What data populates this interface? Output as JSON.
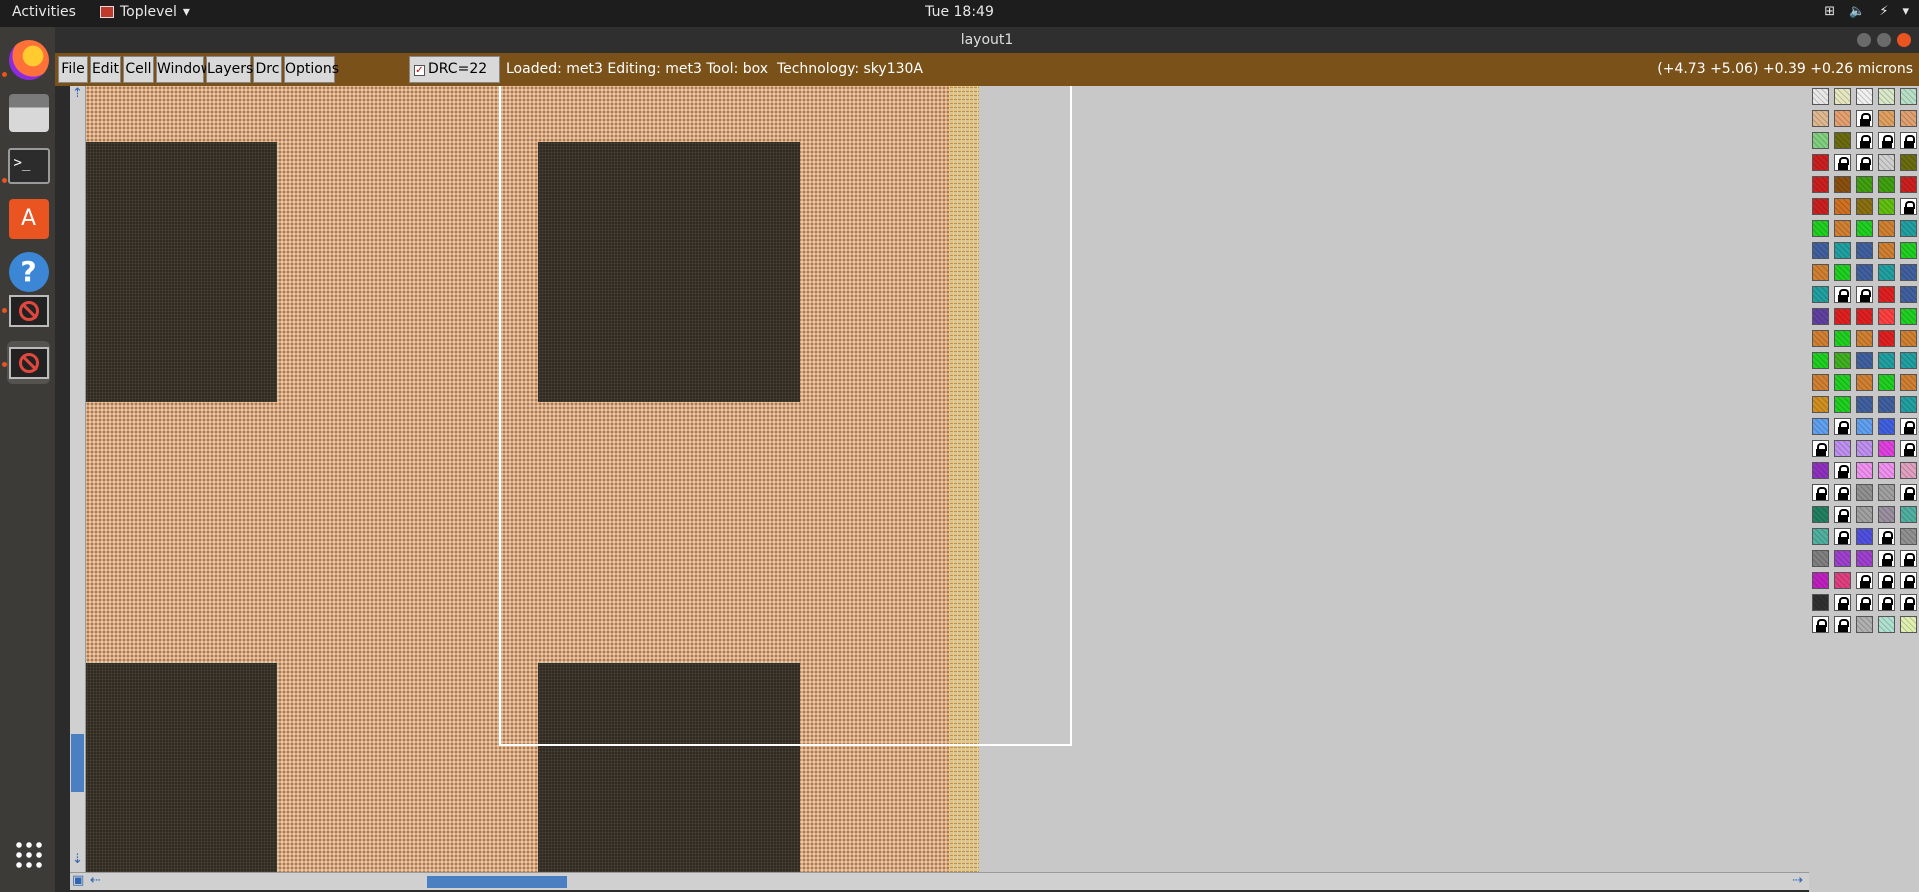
{
  "topbar": {
    "activities": "Activities",
    "app_name": "Toplevel",
    "clock": "Tue 18:49"
  },
  "window": {
    "title": "layout1"
  },
  "menubar": {
    "menus": [
      "File",
      "Edit",
      "Cell",
      "Window",
      "Layers",
      "Drc",
      "Options"
    ],
    "drc_label": "DRC=22",
    "status": "Loaded: met3 Editing: met3 Tool: box  Technology: sky130A",
    "coords": "(+4.73 +5.06) +0.39 +0.26 microns"
  },
  "dock": {
    "items": [
      "firefox-icon",
      "files-icon",
      "terminal-icon",
      "software-center-icon",
      "help-icon",
      "x11-app-icon",
      "x11-app-icon",
      "show-applications-icon"
    ]
  },
  "palette": {
    "rows": [
      [
        "#e8e8e8",
        "#e6e6c0",
        "#f0f0f0",
        "#d8e8c8",
        "#b8e0c8"
      ],
      [
        "#e0b890",
        "#e6a070",
        "lock",
        "#e0a060",
        "#e0a070"
      ],
      [
        "#80d080",
        "#6b6b10",
        "lock",
        "lock",
        "lock"
      ],
      [
        "#cc2020",
        "lock",
        "lock",
        "#d0d0d0",
        "#6b6b10"
      ],
      [
        "#cc2020",
        "#8a5010",
        "#40a010",
        "#40a010",
        "#cc2020"
      ],
      [
        "#cc2020",
        "#d07020",
        "#8a7010",
        "#60c010",
        "lock"
      ],
      [
        "#20d020",
        "#d08030",
        "#20d020",
        "#d08030",
        "#20a0a0"
      ],
      [
        "#4060a0",
        "#20a0a0",
        "#4060a0",
        "#d08030",
        "#20d020"
      ],
      [
        "#d08030",
        "#20d020",
        "#4060a0",
        "#20a0a0",
        "#4060a0"
      ],
      [
        "#20a0a0",
        "lock",
        "lock",
        "#e02020",
        "#4060a0"
      ],
      [
        "#6040a0",
        "#e02020",
        "#e02020",
        "#ff4040",
        "#20d020"
      ],
      [
        "#d08030",
        "#20d020",
        "#d08030",
        "#e02020",
        "#d08030"
      ],
      [
        "#20d020",
        "#40b020",
        "#4060a0",
        "#20a0a0",
        "#20a0a0"
      ],
      [
        "#d08030",
        "#20d020",
        "#d08030",
        "#20d020",
        "#d08030"
      ],
      [
        "#d09020",
        "#20d020",
        "#4060a0",
        "#4060a0",
        "#20a0a0"
      ],
      [
        "#60a0f0",
        "lock",
        "#60a0f0",
        "#4060e0",
        "lock"
      ],
      [
        "lock",
        "#c090f0",
        "#c090f0",
        "#e040e0",
        "lock"
      ],
      [
        "#9030c0",
        "lock",
        "#f090f0",
        "#f090f0",
        "#e0a0c0"
      ],
      [
        "lock",
        "lock",
        "#909090",
        "#a0a0a0",
        "lock"
      ],
      [
        "#208060",
        "lock",
        "#a0a0a0",
        "#9a90a0",
        "#50b0a0"
      ],
      [
        "#50b0a0",
        "lock",
        "#5050e0",
        "lock",
        "#909090"
      ],
      [
        "#808080",
        "#a040d0",
        "#a040d0",
        "lock",
        "lock"
      ],
      [
        "#c020c0",
        "#e04080",
        "lock",
        "lock",
        "lock"
      ],
      [
        "#303030",
        "lock",
        "lock",
        "lock",
        "lock"
      ],
      [
        "lock",
        "lock",
        "#b0b0b0",
        "#b0e0d0",
        "#e0f0b0"
      ]
    ]
  }
}
